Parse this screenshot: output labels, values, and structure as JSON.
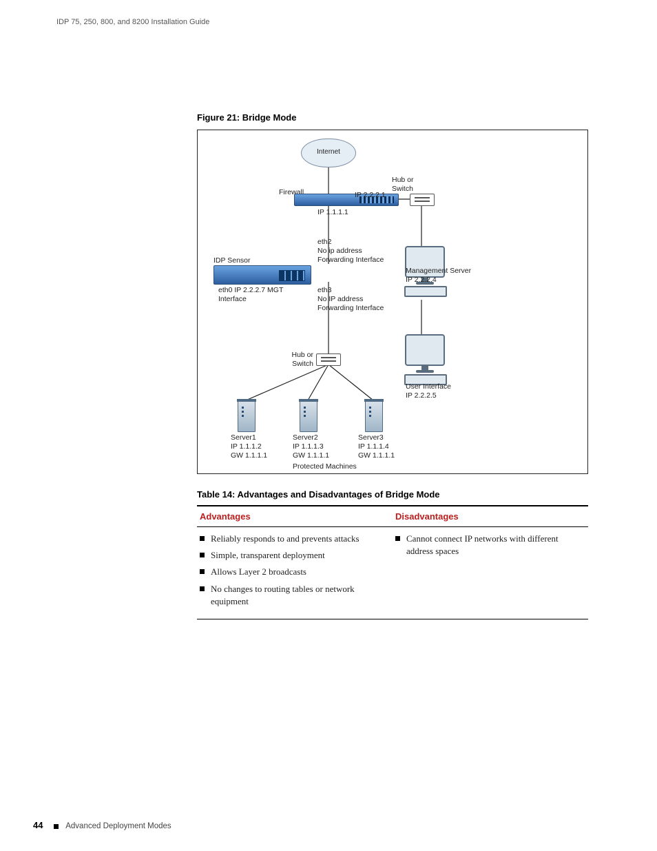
{
  "header": {
    "running_title": "IDP 75, 250, 800, and 8200 Installation Guide"
  },
  "figure": {
    "caption": "Figure 21:  Bridge Mode",
    "internet": "Internet",
    "firewall": "Firewall",
    "ip_2221": "IP 2.2.2.1",
    "ip_1111": "IP 1.1.1.1",
    "hub_switch_top": "Hub or\nSwitch",
    "idp_sensor": "IDP Sensor",
    "eth2": "eth2\nNo ip address\nForwarding Interface",
    "eth0": "eth0 IP 2.2.2.7 MGT\nInterface",
    "eth3": "eth3\nNo IP address\nForwarding Interface",
    "mgmt_server": "Management Server\nIP 2.2.2.4",
    "hub_switch_mid": "Hub or\nSwitch",
    "user_iface": "User Interface\nIP 2.2.2.5",
    "server1": "Server1\nIP 1.1.1.2\nGW 1.1.1.1",
    "server2": "Server2\nIP 1.1.1.3\nGW 1.1.1.1",
    "server3": "Server3\nIP 1.1.1.4\nGW 1.1.1.1",
    "protected": "Protected Machines"
  },
  "table": {
    "caption": "Table 14:  Advantages and Disadvantages of Bridge Mode",
    "col_adv": "Advantages",
    "col_dis": "Disadvantages",
    "adv": [
      "Reliably responds to and prevents attacks",
      "Simple, transparent deployment",
      "Allows Layer 2 broadcasts",
      "No changes to routing tables or network equipment"
    ],
    "dis": [
      "Cannot connect IP networks with different address spaces"
    ]
  },
  "footer": {
    "page": "44",
    "section": "Advanced Deployment Modes"
  }
}
